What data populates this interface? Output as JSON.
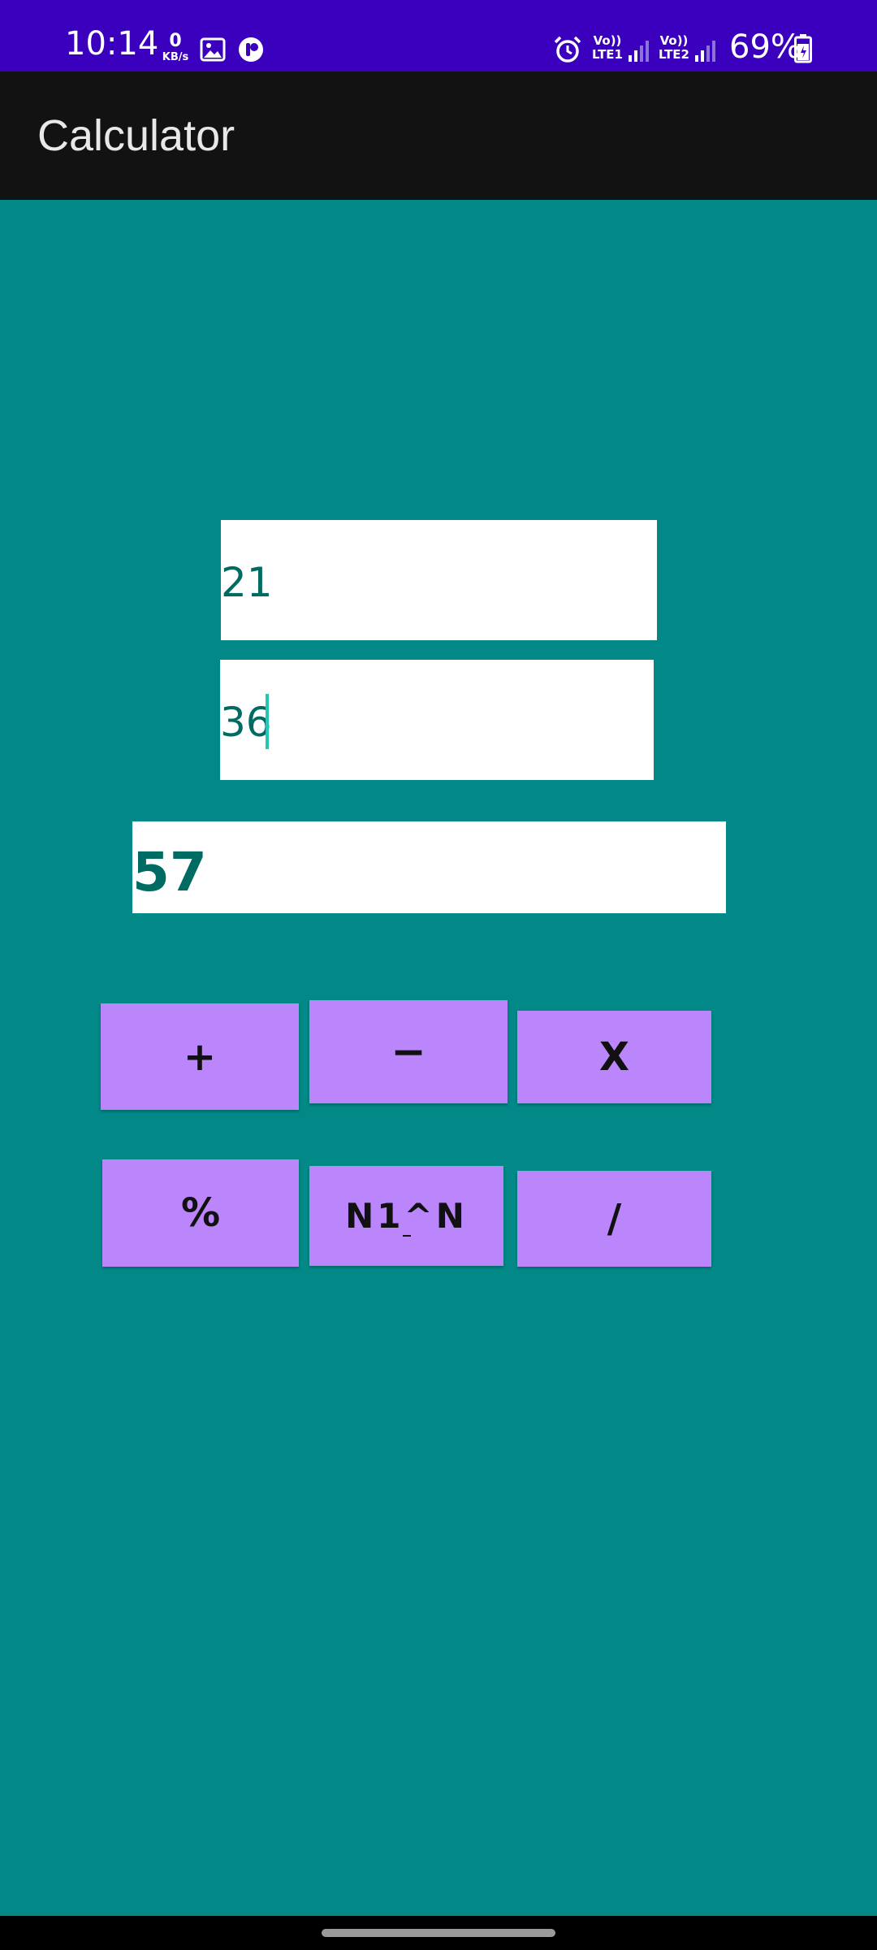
{
  "status_bar": {
    "time": "10:14",
    "net_speed_value": "0",
    "net_speed_unit": "KB/s",
    "sim1_label_top": "Vo))",
    "sim1_label_bottom": "LTE1",
    "sim2_label_top": "Vo))",
    "sim2_label_bottom": "LTE2",
    "battery_percent": "69%",
    "battery_level": 0.69,
    "icons": [
      "gallery-icon",
      "app-notification-icon",
      "alarm-icon",
      "signal-icon",
      "battery-icon"
    ]
  },
  "app_bar": {
    "title": "Calculator"
  },
  "inputs": {
    "first_number": "21",
    "second_number": "36",
    "result": "57"
  },
  "buttons": {
    "add": "+",
    "subtract": "−",
    "multiply": "X",
    "modulo": "%",
    "power": "N1^N",
    "divide": "/"
  },
  "colors": {
    "status_bar": "#3A00BE",
    "app_bar": "#121212",
    "background": "#028887",
    "button": "#BB86FC",
    "text_teal": "#006B63",
    "caret": "#26C6B4"
  }
}
